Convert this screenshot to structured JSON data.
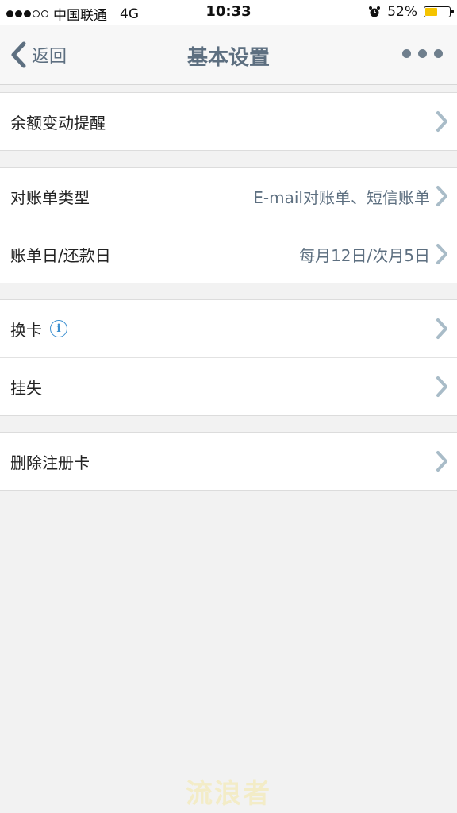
{
  "status_bar": {
    "carrier": "中国联通",
    "network": "4G",
    "time": "10:33",
    "battery_percent": "52%",
    "battery_level": 0.52,
    "signal_strength": 3,
    "signal_max": 5
  },
  "nav": {
    "back_label": "返回",
    "title": "基本设置"
  },
  "groups": [
    {
      "rows": [
        {
          "label": "余额变动提醒",
          "value": ""
        }
      ]
    },
    {
      "rows": [
        {
          "label": "对账单类型",
          "value": "E-mail对账单、短信账单"
        },
        {
          "label": "账单日/还款日",
          "value": "每月12日/次月5日"
        }
      ]
    },
    {
      "rows": [
        {
          "label": "换卡",
          "value": "",
          "info_icon": "i"
        },
        {
          "label": "挂失",
          "value": ""
        }
      ]
    },
    {
      "rows": [
        {
          "label": "删除注册卡",
          "value": ""
        }
      ]
    }
  ],
  "watermark": "流浪者",
  "colors": {
    "accent": "#5d6f80",
    "chevron": "#a9bcc8",
    "info": "#3b8fd0",
    "battery": "#f5c400"
  }
}
